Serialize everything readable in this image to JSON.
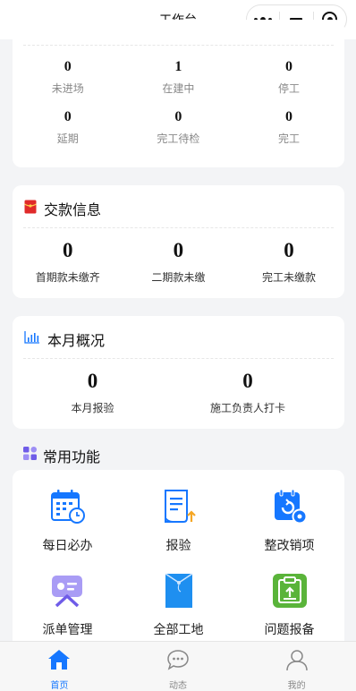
{
  "nav": {
    "title": "工作台"
  },
  "status_card": {
    "row1": [
      {
        "value": "0",
        "label": "未进场"
      },
      {
        "value": "1",
        "label": "在建中"
      },
      {
        "value": "0",
        "label": "停工"
      }
    ],
    "row2": [
      {
        "value": "0",
        "label": "延期"
      },
      {
        "value": "0",
        "label": "完工待检"
      },
      {
        "value": "0",
        "label": "完工"
      }
    ]
  },
  "payment_card": {
    "title": "交款信息",
    "icon": "red-envelope-icon",
    "items": [
      {
        "value": "0",
        "label": "首期款未缴齐"
      },
      {
        "value": "0",
        "label": "二期款未缴"
      },
      {
        "value": "0",
        "label": "完工未缴款"
      }
    ]
  },
  "month_card": {
    "title": "本月概况",
    "icon": "bar-chart-icon",
    "items": [
      {
        "value": "0",
        "label": "本月报验"
      },
      {
        "value": "0",
        "label": "施工负责人打卡"
      }
    ]
  },
  "functions": {
    "title": "常用功能",
    "icon": "apps-grid-icon",
    "items": [
      {
        "label": "每日必办",
        "icon": "calendar-clock-icon"
      },
      {
        "label": "报验",
        "icon": "report-document-icon"
      },
      {
        "label": "整改销项",
        "icon": "rectify-settings-icon"
      },
      {
        "label": "派单管理",
        "icon": "dispatch-card-icon"
      },
      {
        "label": "全部工地",
        "icon": "folder-icon"
      },
      {
        "label": "问题报备",
        "icon": "upload-report-icon"
      }
    ]
  },
  "tabbar": {
    "items": [
      {
        "label": "首页",
        "icon": "home-icon",
        "active": true
      },
      {
        "label": "动态",
        "icon": "chat-bubble-icon",
        "active": false
      },
      {
        "label": "我的",
        "icon": "user-icon",
        "active": false
      }
    ]
  },
  "colors": {
    "accent": "#1677ff",
    "red": "#e02a2a",
    "green": "#5ab43a",
    "purple": "#8c7cf0"
  }
}
